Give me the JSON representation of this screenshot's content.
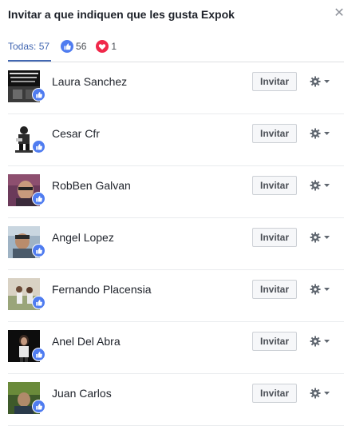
{
  "dialog": {
    "title": "Invitar a que indiquen que les gusta Expok",
    "close_icon": "close-icon"
  },
  "tabs": [
    {
      "label": "Todas: 57",
      "active": true
    },
    {
      "icon": "like-icon",
      "count": "56"
    },
    {
      "icon": "love-icon",
      "count": "1"
    }
  ],
  "colors": {
    "accent": "#4267b2",
    "like": "#4f7cf0",
    "love": "#f0284a"
  },
  "people": [
    {
      "name": "Laura Sanchez",
      "button": "Invitar",
      "reaction": "like"
    },
    {
      "name": "Cesar Cfr",
      "button": "Invitar",
      "reaction": "like"
    },
    {
      "name": "RobBen Galvan",
      "button": "Invitar",
      "reaction": "like"
    },
    {
      "name": "Angel Lopez",
      "button": "Invitar",
      "reaction": "like"
    },
    {
      "name": "Fernando Placensia",
      "button": "Invitar",
      "reaction": "like"
    },
    {
      "name": "Anel Del Abra",
      "button": "Invitar",
      "reaction": "like"
    },
    {
      "name": "Juan Carlos",
      "button": "Invitar",
      "reaction": "like"
    }
  ]
}
